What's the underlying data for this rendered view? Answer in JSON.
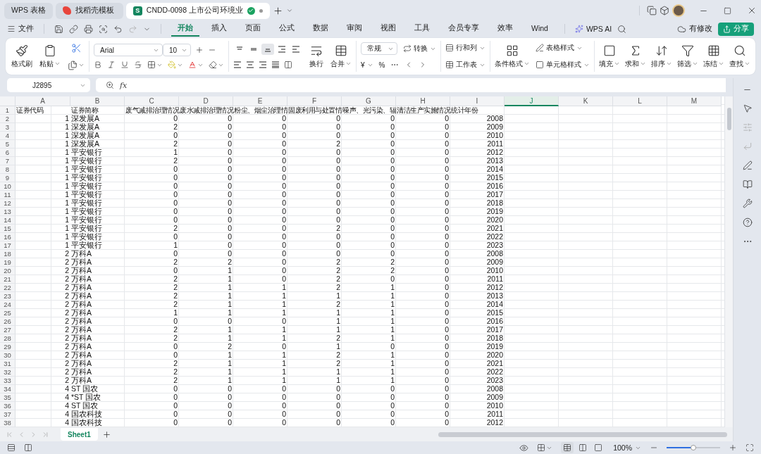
{
  "window": {
    "tabs": [
      {
        "label": "WPS 表格",
        "kind": "home",
        "selected": false
      },
      {
        "label": "找稻壳模板",
        "kind": "template",
        "selected": false
      },
      {
        "label": "CNDD-0098 上市公司环境业",
        "kind": "document",
        "app_letter": "S",
        "selected": true
      }
    ]
  },
  "menu": {
    "file": "文件",
    "tabs": [
      {
        "label": "开始",
        "selected": true
      },
      {
        "label": "插入",
        "selected": false
      },
      {
        "label": "页面",
        "selected": false
      },
      {
        "label": "公式",
        "selected": false
      },
      {
        "label": "数据",
        "selected": false
      },
      {
        "label": "审阅",
        "selected": false
      },
      {
        "label": "视图",
        "selected": false
      },
      {
        "label": "工具",
        "selected": false
      },
      {
        "label": "会员专享",
        "selected": false
      },
      {
        "label": "效率",
        "selected": false
      },
      {
        "label": "Wind",
        "selected": false
      }
    ],
    "ai": "WPS AI",
    "save_state": "有修改",
    "share": "分享"
  },
  "ribbon": {
    "clipboard": [
      "格式刷",
      "粘贴"
    ],
    "font": {
      "name": "Arial",
      "size": "10"
    },
    "paragraph": {
      "align_buttons": [
        {
          "on": false
        },
        {
          "on": false
        },
        {
          "on": true
        },
        {
          "on": false
        },
        {
          "on": false
        }
      ],
      "wrap": "换行",
      "merge": "合并"
    },
    "number": {
      "format": "常规",
      "convert": "转换",
      "currency": "¥",
      "percent": "%"
    },
    "cells": [
      "行和列",
      "工作表"
    ],
    "styles": {
      "conditional": "条件格式",
      "table_style": "表格样式",
      "cell_style": "单元格样式"
    },
    "editing": [
      "填充",
      "求和",
      "排序",
      "筛选",
      "冻结",
      "查找"
    ]
  },
  "formula_bar": {
    "name_box": "J2895",
    "fx": "fx"
  },
  "sheet": {
    "columns": [
      {
        "letter": "A",
        "kind": "number",
        "selected": false
      },
      {
        "letter": "B",
        "kind": "text",
        "selected": false
      },
      {
        "letter": "C",
        "kind": "number",
        "selected": false
      },
      {
        "letter": "D",
        "kind": "number",
        "selected": false
      },
      {
        "letter": "E",
        "kind": "number",
        "selected": false
      },
      {
        "letter": "F",
        "kind": "number",
        "selected": false
      },
      {
        "letter": "G",
        "kind": "number",
        "selected": false
      },
      {
        "letter": "H",
        "kind": "number",
        "selected": false
      },
      {
        "letter": "I",
        "kind": "number",
        "selected": false
      },
      {
        "letter": "J",
        "selected": true
      },
      {
        "letter": "K",
        "selected": false
      },
      {
        "letter": "L",
        "selected": false
      },
      {
        "letter": "M",
        "selected": false
      }
    ],
    "header_row": {
      "number": "1",
      "cells": [
        "证券代码",
        "证券简称",
        "废气减排治理情况",
        "废水减排治理情况",
        "粉尘、烟尘治理情",
        "固废利用与处置情",
        "噪声、光污染、辐",
        "清洁生产实施情况",
        "统计年份"
      ]
    },
    "rows": [
      {
        "number": "2",
        "cells": [
          "1",
          "深发展A",
          "0",
          "0",
          "0",
          "0",
          "0",
          "0",
          "2008"
        ]
      },
      {
        "number": "3",
        "cells": [
          "1",
          "深发展A",
          "2",
          "0",
          "0",
          "0",
          "0",
          "0",
          "2009"
        ]
      },
      {
        "number": "4",
        "cells": [
          "1",
          "深发展A",
          "0",
          "0",
          "0",
          "0",
          "0",
          "0",
          "2010"
        ]
      },
      {
        "number": "5",
        "cells": [
          "1",
          "深发展A",
          "2",
          "0",
          "0",
          "2",
          "0",
          "0",
          "2011"
        ]
      },
      {
        "number": "6",
        "cells": [
          "1",
          "平安银行",
          "1",
          "0",
          "0",
          "0",
          "0",
          "0",
          "2012"
        ]
      },
      {
        "number": "7",
        "cells": [
          "1",
          "平安银行",
          "2",
          "0",
          "0",
          "0",
          "0",
          "0",
          "2013"
        ]
      },
      {
        "number": "8",
        "cells": [
          "1",
          "平安银行",
          "0",
          "0",
          "0",
          "0",
          "0",
          "0",
          "2014"
        ]
      },
      {
        "number": "9",
        "cells": [
          "1",
          "平安银行",
          "0",
          "0",
          "0",
          "0",
          "0",
          "0",
          "2015"
        ]
      },
      {
        "number": "10",
        "cells": [
          "1",
          "平安银行",
          "0",
          "0",
          "0",
          "0",
          "0",
          "0",
          "2016"
        ]
      },
      {
        "number": "11",
        "cells": [
          "1",
          "平安银行",
          "0",
          "0",
          "0",
          "0",
          "0",
          "0",
          "2017"
        ]
      },
      {
        "number": "12",
        "cells": [
          "1",
          "平安银行",
          "0",
          "0",
          "0",
          "0",
          "0",
          "0",
          "2018"
        ]
      },
      {
        "number": "13",
        "cells": [
          "1",
          "平安银行",
          "0",
          "0",
          "0",
          "0",
          "0",
          "0",
          "2019"
        ]
      },
      {
        "number": "14",
        "cells": [
          "1",
          "平安银行",
          "0",
          "0",
          "0",
          "0",
          "0",
          "0",
          "2020"
        ]
      },
      {
        "number": "15",
        "cells": [
          "1",
          "平安银行",
          "2",
          "0",
          "0",
          "2",
          "0",
          "0",
          "2021"
        ]
      },
      {
        "number": "16",
        "cells": [
          "1",
          "平安银行",
          "0",
          "0",
          "0",
          "0",
          "0",
          "0",
          "2022"
        ]
      },
      {
        "number": "17",
        "cells": [
          "1",
          "平安银行",
          "1",
          "0",
          "0",
          "0",
          "0",
          "0",
          "2023"
        ]
      },
      {
        "number": "18",
        "cells": [
          "2",
          "万科A",
          "0",
          "0",
          "0",
          "0",
          "0",
          "0",
          "2008"
        ]
      },
      {
        "number": "19",
        "cells": [
          "2",
          "万科A",
          "2",
          "2",
          "0",
          "2",
          "2",
          "0",
          "2009"
        ]
      },
      {
        "number": "20",
        "cells": [
          "2",
          "万科A",
          "0",
          "1",
          "0",
          "2",
          "2",
          "0",
          "2010"
        ]
      },
      {
        "number": "21",
        "cells": [
          "2",
          "万科A",
          "2",
          "1",
          "0",
          "2",
          "0",
          "0",
          "2011"
        ]
      },
      {
        "number": "22",
        "cells": [
          "2",
          "万科A",
          "2",
          "1",
          "1",
          "2",
          "1",
          "0",
          "2012"
        ]
      },
      {
        "number": "23",
        "cells": [
          "2",
          "万科A",
          "2",
          "1",
          "1",
          "1",
          "1",
          "0",
          "2013"
        ]
      },
      {
        "number": "24",
        "cells": [
          "2",
          "万科A",
          "2",
          "1",
          "1",
          "2",
          "1",
          "0",
          "2014"
        ]
      },
      {
        "number": "25",
        "cells": [
          "2",
          "万科A",
          "1",
          "1",
          "1",
          "1",
          "1",
          "0",
          "2015"
        ]
      },
      {
        "number": "26",
        "cells": [
          "2",
          "万科A",
          "0",
          "0",
          "0",
          "1",
          "1",
          "0",
          "2016"
        ]
      },
      {
        "number": "27",
        "cells": [
          "2",
          "万科A",
          "2",
          "1",
          "1",
          "1",
          "1",
          "0",
          "2017"
        ]
      },
      {
        "number": "28",
        "cells": [
          "2",
          "万科A",
          "2",
          "1",
          "1",
          "2",
          "1",
          "0",
          "2018"
        ]
      },
      {
        "number": "29",
        "cells": [
          "2",
          "万科A",
          "0",
          "2",
          "0",
          "1",
          "0",
          "0",
          "2019"
        ]
      },
      {
        "number": "30",
        "cells": [
          "2",
          "万科A",
          "0",
          "1",
          "1",
          "2",
          "1",
          "0",
          "2020"
        ]
      },
      {
        "number": "31",
        "cells": [
          "2",
          "万科A",
          "2",
          "1",
          "1",
          "2",
          "1",
          "0",
          "2021"
        ]
      },
      {
        "number": "32",
        "cells": [
          "2",
          "万科A",
          "2",
          "1",
          "1",
          "1",
          "1",
          "0",
          "2022"
        ]
      },
      {
        "number": "33",
        "cells": [
          "2",
          "万科A",
          "2",
          "1",
          "1",
          "1",
          "1",
          "0",
          "2023"
        ]
      },
      {
        "number": "34",
        "cells": [
          "4",
          "ST 国农",
          "0",
          "0",
          "0",
          "0",
          "0",
          "0",
          "2008"
        ]
      },
      {
        "number": "35",
        "cells": [
          "4",
          "*ST 国农",
          "0",
          "0",
          "0",
          "0",
          "0",
          "0",
          "2009"
        ]
      },
      {
        "number": "36",
        "cells": [
          "4",
          "ST 国农",
          "0",
          "0",
          "0",
          "0",
          "0",
          "0",
          "2010"
        ]
      },
      {
        "number": "37",
        "cells": [
          "4",
          "国农科技",
          "0",
          "0",
          "0",
          "0",
          "0",
          "0",
          "2011"
        ]
      },
      {
        "number": "38",
        "cells": [
          "4",
          "国农科技",
          "0",
          "0",
          "0",
          "0",
          "0",
          "0",
          "2012"
        ]
      }
    ]
  },
  "sheet_tabs": [
    {
      "label": "Sheet1",
      "selected": true
    }
  ],
  "status_bar": {
    "zoom": "100%",
    "zoom_slider": {
      "level": 0.5
    }
  }
}
